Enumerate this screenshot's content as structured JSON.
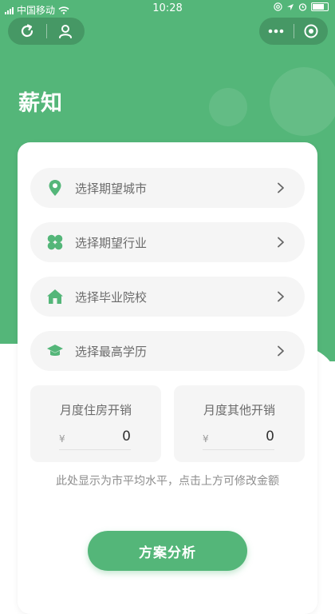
{
  "status_bar": {
    "carrier": "中国移动",
    "time": "10:28"
  },
  "nav": {
    "left_icons": [
      "refresh-icon",
      "user-icon"
    ],
    "right_icons": [
      "more-icon",
      "target-icon"
    ]
  },
  "brand": {
    "title": "薪知"
  },
  "selectors": [
    {
      "label": "选择期望城市",
      "icon": "location-pin-icon"
    },
    {
      "label": "选择期望行业",
      "icon": "clover-icon"
    },
    {
      "label": "选择毕业院校",
      "icon": "house-icon"
    },
    {
      "label": "选择最高学历",
      "icon": "graduation-cap-icon"
    }
  ],
  "costs": {
    "housing": {
      "title": "月度住房开销",
      "currency": "¥",
      "value": "0"
    },
    "other": {
      "title": "月度其他开销",
      "currency": "¥",
      "value": "0"
    }
  },
  "hint": "此处显示为市平均水平，点击上方可修改金额",
  "submit_label": "方案分析",
  "colors": {
    "brand_green": "#54b679",
    "row_bg": "#f5f5f5",
    "text_gray": "#6b6b6b"
  }
}
